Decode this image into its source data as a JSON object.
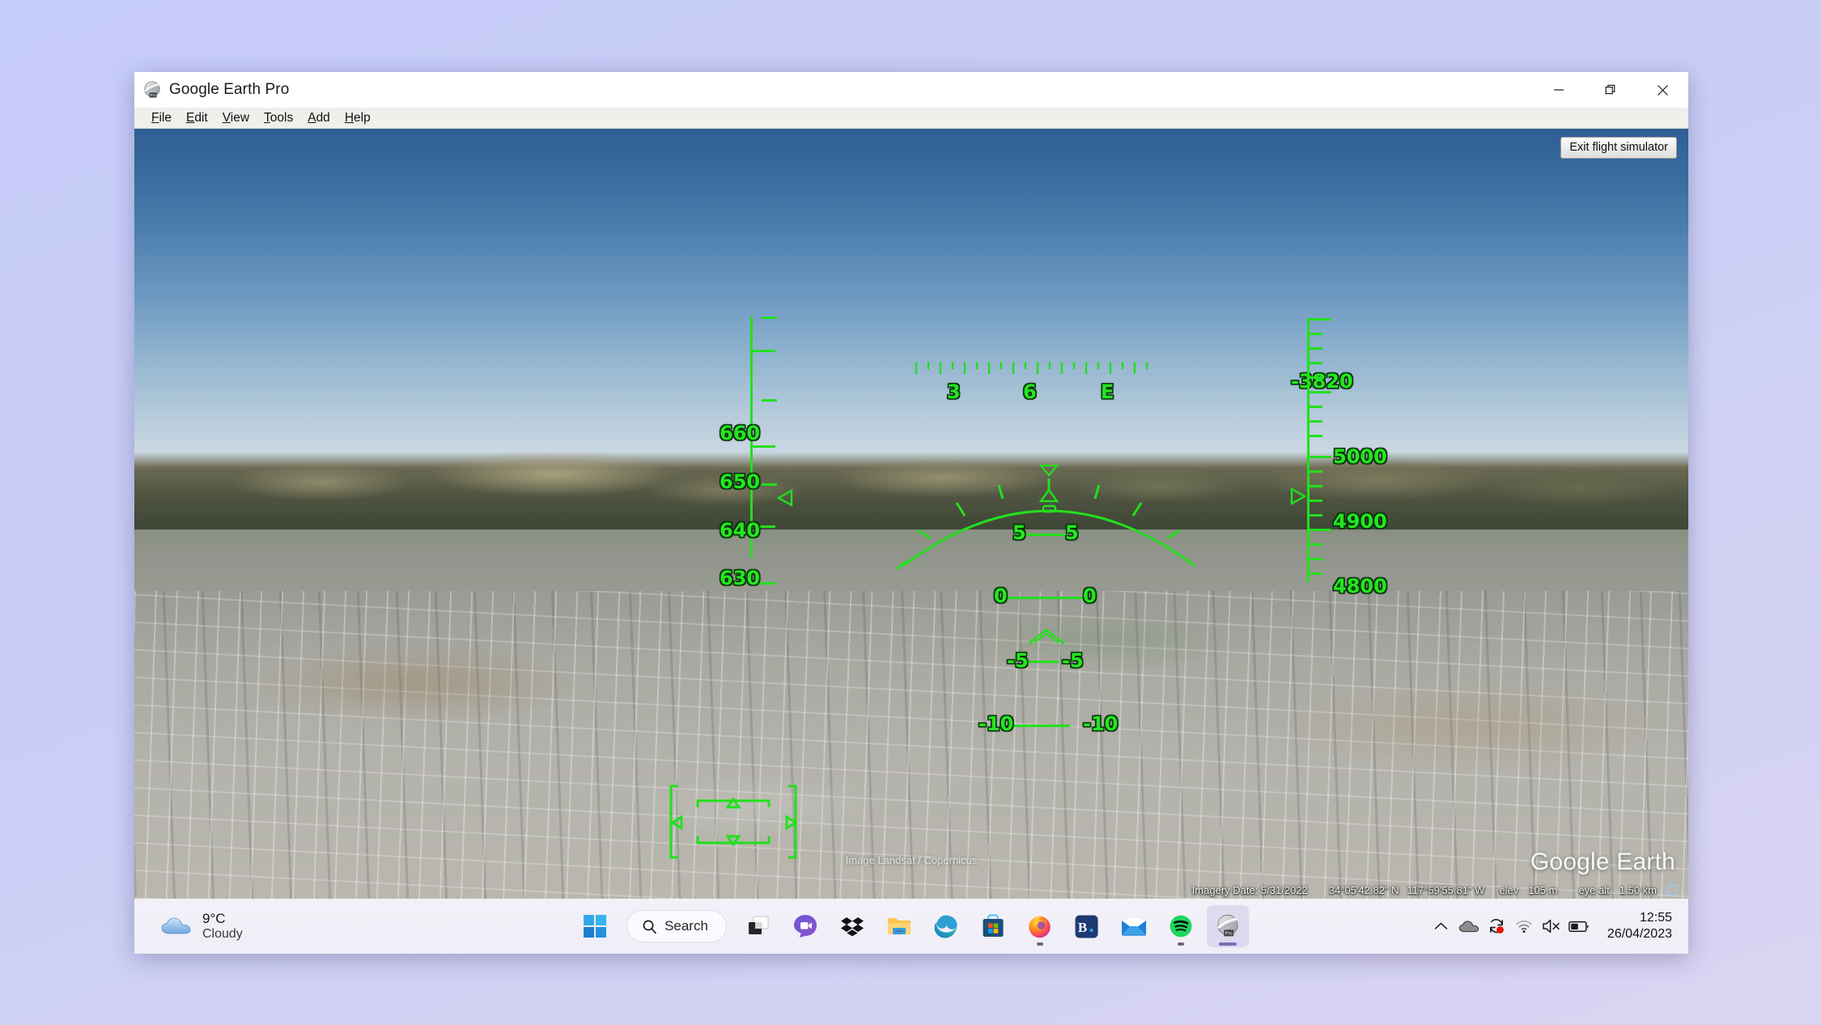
{
  "window": {
    "title": "Google Earth Pro",
    "icon": "google-earth-globe-icon",
    "controls": {
      "minimize": "minimize-icon",
      "restore": "restore-icon",
      "close": "close-icon"
    }
  },
  "menu": {
    "items": [
      {
        "label": "File",
        "accel": "F"
      },
      {
        "label": "Edit",
        "accel": "E"
      },
      {
        "label": "View",
        "accel": "V"
      },
      {
        "label": "Tools",
        "accel": "T"
      },
      {
        "label": "Add",
        "accel": "A"
      },
      {
        "label": "Help",
        "accel": "H"
      }
    ]
  },
  "viewport": {
    "exit_button_label": "Exit flight simulator",
    "attribution": "Image Landsat / Copernicus",
    "watermark": "Google Earth"
  },
  "status_bar": {
    "imagery_date": "Imagery Date: 5/31/2022",
    "latitude": "34°05'42.82\" N",
    "longitude": "117°59'55.81\" W",
    "elev_label": "elev",
    "elev_value": "105 m",
    "eye_alt_label": "eye alt",
    "eye_alt_value": "1.50 km"
  },
  "hud": {
    "color": "#22e01c",
    "compass": {
      "labels": [
        "3",
        "6",
        "E"
      ]
    },
    "speed_tape": {
      "labels": [
        "660",
        "650",
        "640",
        "630"
      ],
      "indicator": "left-triangle"
    },
    "altitude_tape": {
      "labels": [
        "5000",
        "4900",
        "4800"
      ],
      "indicator": "right-triangle"
    },
    "vertical_speed": "-3820",
    "pitch_ladder": [
      {
        "value": "5",
        "left": "5",
        "right": "5"
      },
      {
        "value": "0",
        "left": "0",
        "right": "0"
      },
      {
        "value": "-5",
        "left": "-5",
        "right": "-5"
      },
      {
        "value": "-10",
        "left": "-10",
        "right": "-10"
      }
    ]
  },
  "taskbar": {
    "weather": {
      "temperature": "9°C",
      "condition": "Cloudy",
      "icon": "cloud-icon"
    },
    "search": {
      "label": "Search",
      "icon": "search-icon"
    },
    "apps": [
      {
        "name": "start",
        "icon": "windows-logo-icon",
        "running": false
      },
      {
        "name": "task-view",
        "icon": "task-view-icon",
        "running": false
      },
      {
        "name": "teams-chat",
        "icon": "teams-chat-icon",
        "running": false
      },
      {
        "name": "dropbox",
        "icon": "dropbox-icon",
        "running": false
      },
      {
        "name": "file-explorer",
        "icon": "folder-icon",
        "running": false
      },
      {
        "name": "microsoft-edge",
        "icon": "edge-icon",
        "running": false
      },
      {
        "name": "microsoft-store",
        "icon": "store-icon",
        "running": false
      },
      {
        "name": "firefox",
        "icon": "firefox-icon",
        "running": true
      },
      {
        "name": "booking",
        "icon": "booking-icon",
        "running": false
      },
      {
        "name": "mail",
        "icon": "mail-icon",
        "running": false
      },
      {
        "name": "spotify",
        "icon": "spotify-icon",
        "running": true
      },
      {
        "name": "google-earth",
        "icon": "google-earth-icon",
        "running": true,
        "active": true
      }
    ],
    "tray": [
      {
        "name": "show-hidden-icons",
        "icon": "chevron-up-icon"
      },
      {
        "name": "onedrive",
        "icon": "cloud-icon"
      },
      {
        "name": "windows-update",
        "icon": "sync-icon",
        "badge": true
      },
      {
        "name": "network",
        "icon": "wifi-icon"
      },
      {
        "name": "volume",
        "icon": "speaker-muted-icon"
      },
      {
        "name": "battery",
        "icon": "battery-icon"
      }
    ],
    "clock": {
      "time": "12:55",
      "date": "26/04/2023"
    }
  }
}
